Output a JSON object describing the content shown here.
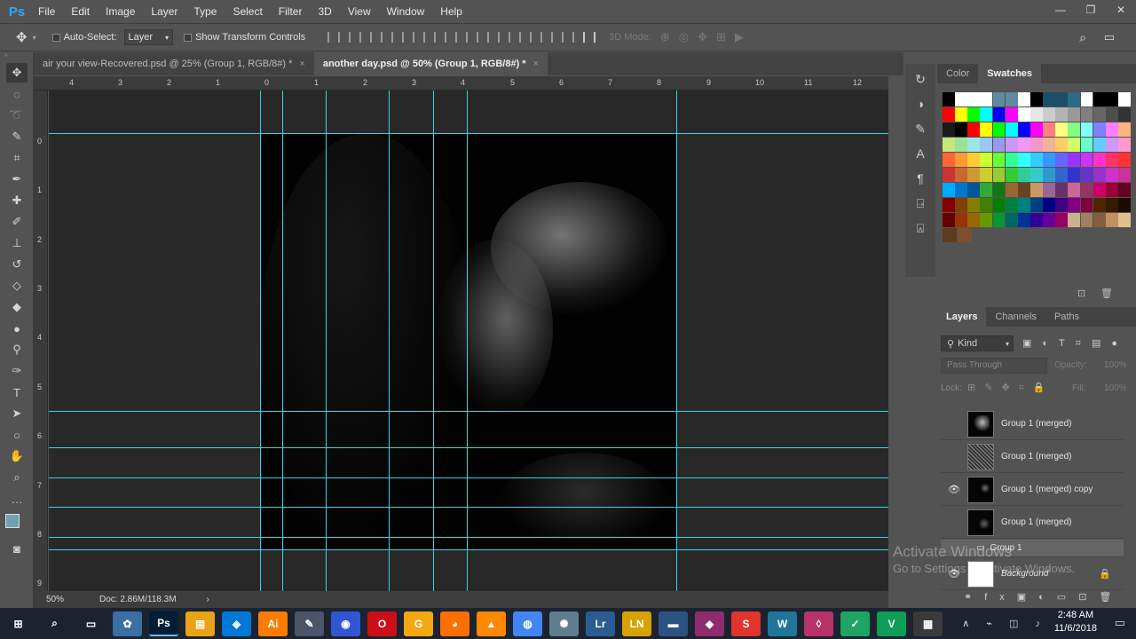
{
  "app": {
    "logo": "Ps"
  },
  "menu": [
    "File",
    "Edit",
    "Image",
    "Layer",
    "Type",
    "Select",
    "Filter",
    "3D",
    "View",
    "Window",
    "Help"
  ],
  "window_controls": {
    "minimize": "—",
    "restore": "❐",
    "close": "✕"
  },
  "options": {
    "auto_select_label": "Auto-Select:",
    "auto_select_value": "Layer",
    "show_transform_label": "Show Transform Controls",
    "mode_3d_label": "3D Mode:"
  },
  "tabs": [
    {
      "label": "air your view-Recovered.psd @ 25% (Group 1, RGB/8#) *",
      "close": "×"
    },
    {
      "label": "another day.psd @ 50% (Group 1, RGB/8#) *",
      "close": "×"
    }
  ],
  "ruler": {
    "h_labels": [
      "4",
      "3",
      "2",
      "1",
      "0",
      "1",
      "2",
      "3",
      "4",
      "5",
      "6",
      "7",
      "8",
      "9",
      "10",
      "11",
      "12"
    ],
    "v_labels": [
      "0",
      "1",
      "2",
      "3",
      "4",
      "5",
      "6",
      "7",
      "8",
      "9"
    ]
  },
  "status": {
    "zoom": "50%",
    "doc": "Doc: 2.86M/118.3M",
    "arrow": "›"
  },
  "swatches_panel": {
    "tabs": [
      "Color",
      "Swatches"
    ]
  },
  "layers_panel": {
    "tabs": [
      "Layers",
      "Channels",
      "Paths"
    ],
    "filter_kind": "Kind",
    "blend_mode": "Pass Through",
    "opacity_label": "Opacity:",
    "opacity_value": "100%",
    "lock_label": "Lock:",
    "fill_label": "Fill:",
    "fill_value": "100%",
    "layers": [
      {
        "name": "Group 1 (merged)",
        "visible": false
      },
      {
        "name": "Group 1 (merged)",
        "visible": false
      },
      {
        "name": "Group 1 (merged) copy",
        "visible": true
      },
      {
        "name": "Group 1 (merged)",
        "visible": false
      },
      {
        "name": "Group 1",
        "visible": false
      },
      {
        "name": "Background",
        "visible": true
      }
    ]
  },
  "watermark": {
    "line1": "Activate Windows",
    "line2": "Go to Settings to activate Windows."
  },
  "taskbar": {
    "apps": [
      "⊞",
      "⌕",
      "▭",
      "✿",
      "Ps",
      "▤",
      "◈",
      "Ai",
      "✎",
      "◉",
      "O",
      "G",
      "◕",
      "▲",
      "◍",
      "✺",
      "Lr",
      "LN",
      "▬",
      "◆",
      "S",
      "W",
      "◊",
      "✓",
      "V",
      "▦"
    ],
    "time": "2:48 AM",
    "date": "11/6/2018"
  }
}
